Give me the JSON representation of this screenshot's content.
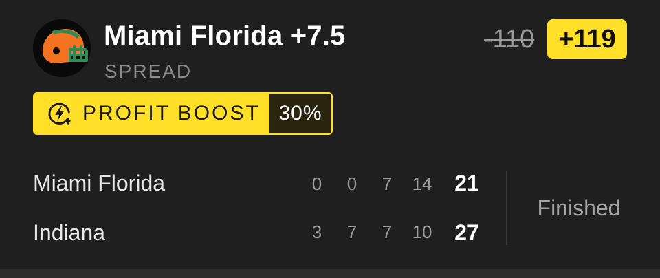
{
  "bet": {
    "selection": "Miami Florida +7.5",
    "market": "SPREAD",
    "original_odds": "-110",
    "boosted_odds": "+119",
    "team_logo": "football-helmet-icon",
    "colors": {
      "accent": "#ffdf27",
      "helmet": "#f37321",
      "facemask": "#2e8b57",
      "background": "#1f1f1f"
    }
  },
  "boost": {
    "icon": "lightning-bolt-icon",
    "label": "PROFIT BOOST",
    "percent": "30%"
  },
  "scoreboard": {
    "teams": [
      {
        "name": "Miami Florida",
        "quarters": [
          "0",
          "0",
          "7",
          "14"
        ],
        "total": "21"
      },
      {
        "name": "Indiana",
        "quarters": [
          "3",
          "7",
          "7",
          "10"
        ],
        "total": "27"
      }
    ],
    "status": "Finished"
  }
}
